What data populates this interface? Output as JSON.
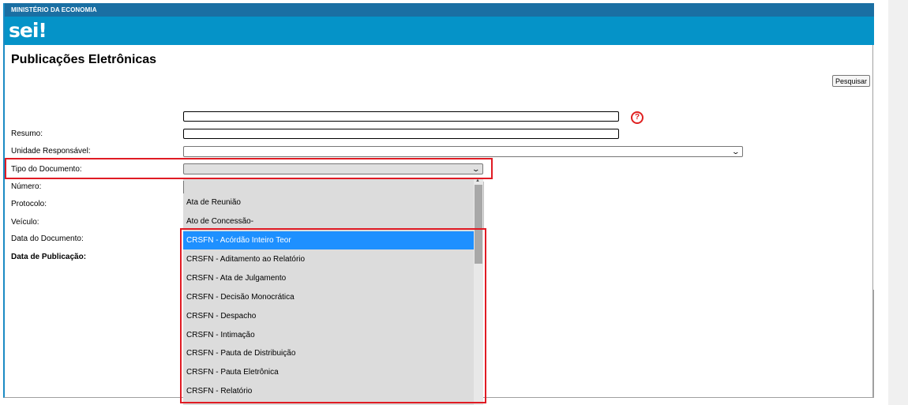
{
  "header": {
    "ministry": "MINISTÉRIO DA ECONOMIA",
    "logo": "sei!"
  },
  "page": {
    "title": "Publicações Eletrônicas",
    "search_button": "Pesquisar"
  },
  "form": {
    "labels": {
      "resumo": "Resumo:",
      "unidade": "Unidade Responsável:",
      "tipo": "Tipo do Documento:",
      "numero": "Número:",
      "protocolo": "Protocolo:",
      "veiculo": "Veículo:",
      "data_documento": "Data do Documento:",
      "data_publicacao": "Data de Publicação:"
    },
    "values": {
      "texto_livre": "",
      "resumo": "",
      "unidade": "",
      "tipo": ""
    },
    "help_icon": "question-circle-icon"
  },
  "dropdown": {
    "options": [
      "Ata de Reunião",
      "Ato de Concessão-",
      "CRSFN - Acórdão Inteiro Teor",
      "CRSFN - Aditamento ao Relatório",
      "CRSFN - Ata de Julgamento",
      "CRSFN - Decisão Monocrática",
      "CRSFN - Despacho",
      "CRSFN - Intimação",
      "CRSFN - Pauta de Distribuição",
      "CRSFN - Pauta Eletrônica",
      "CRSFN - Relatório"
    ],
    "highlighted": "CRSFN - Acórdão Inteiro Teor"
  },
  "colors": {
    "header_band": "#0593c8",
    "header_strip": "#1a6fa3",
    "highlight_box": "#e01b24",
    "selected_option": "#1e90ff",
    "help_icon": "#e02020"
  }
}
